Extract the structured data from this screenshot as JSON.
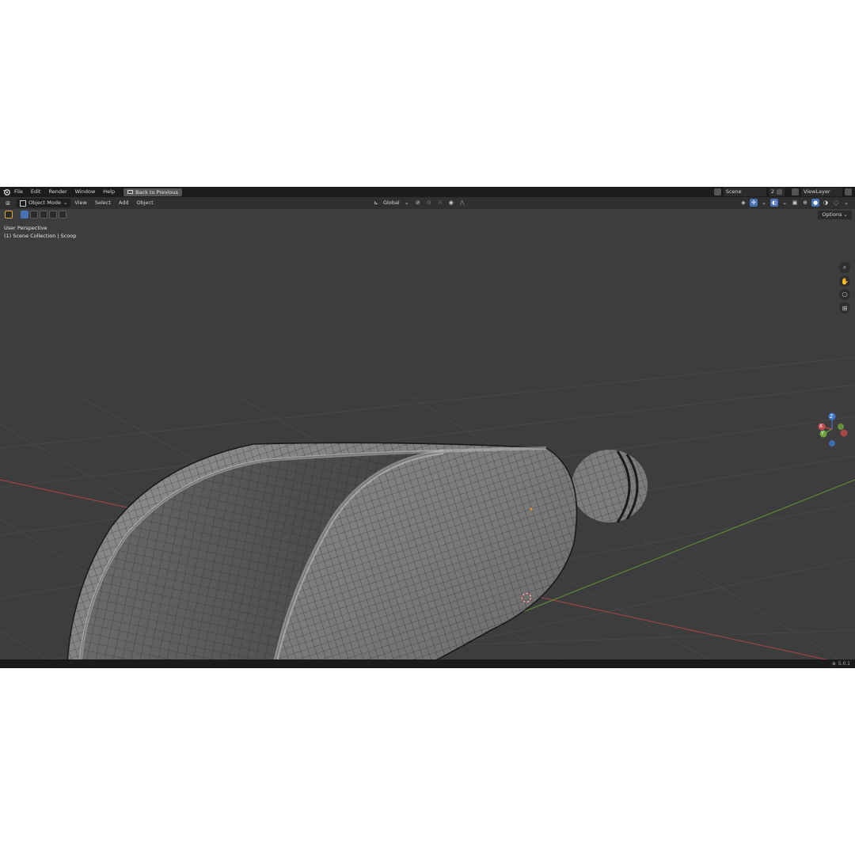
{
  "menu": [
    "File",
    "Edit",
    "Render",
    "Window",
    "Help"
  ],
  "back_button": "Back to Previous",
  "scene": {
    "name": "Scene",
    "number": "2",
    "view_layer": "ViewLayer"
  },
  "header": {
    "mode": "Object Mode",
    "menus": [
      "View",
      "Select",
      "Add",
      "Object"
    ],
    "orientation": "Global"
  },
  "options_label": "Options",
  "viewport": {
    "perspective": "User Perspective",
    "collection": "(1) Scene Collection | Scoop"
  },
  "gizmo": {
    "z": "Z",
    "y": "Y",
    "x": "X"
  },
  "status": {
    "version": "5.0.1"
  },
  "icons": [
    "blender-logo-icon",
    "search-icon",
    "hand-icon",
    "camera-icon",
    "grid-icon",
    "globe-icon"
  ],
  "colors": {
    "x_axis": "#c24a4f",
    "y_axis": "#6ea23c",
    "z_axis": "#3f78c9",
    "accent": "#4772b3"
  }
}
